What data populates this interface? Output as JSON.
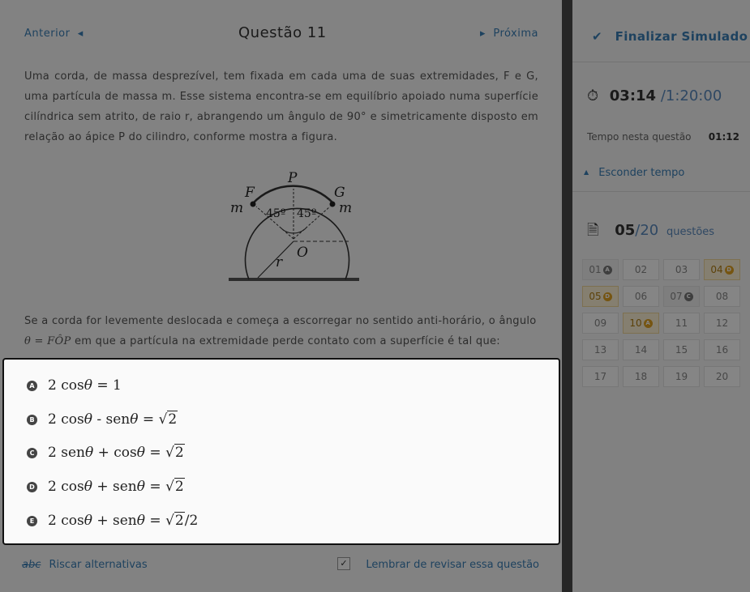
{
  "nav": {
    "prev_label": "Anterior",
    "prev_icon": "chevron-left-icon",
    "title": "Questão 11",
    "next_label": "Próxima",
    "next_icon": "chevron-right-icon"
  },
  "question": {
    "text1": "Uma corda, de massa desprezível, tem fixada em cada uma de suas extremidades, F e G, uma partícula de massa m. Esse sistema encontra-se em equilíbrio apoiado numa superfície cilíndrica sem atrito, de raio r, abrangendo um ângulo de 90° e simetricamente disposto em relação ao ápice P do cilindro, conforme mostra a figura.",
    "text2_pre": "Se a corda for levemente deslocada e começa a escorregar no sentido anti-horário, o ângulo",
    "text2_math": "θ = FÔP",
    "text2_post": " em que a partícula na extremidade  perde contato com a superfície é tal que:",
    "figure": {
      "p": "P",
      "f": "F",
      "g": "G",
      "m_left": "m",
      "m_right": "m",
      "angle_left": "45º",
      "angle_right": "45º",
      "o": "O",
      "r": "r"
    }
  },
  "options": [
    {
      "letter": "A",
      "pre": "2 cos",
      "theta": "θ",
      "mid": " = 1",
      "mid2": "",
      "theta2": "",
      "rhs_sqrt": "",
      "tail": ""
    },
    {
      "letter": "B",
      "pre": "2 cos",
      "theta": "θ",
      "mid": " - sen",
      "theta2": "θ",
      "mid2": " = ",
      "rhs_sqrt": "2",
      "tail": ""
    },
    {
      "letter": "C",
      "pre": "2 sen",
      "theta": "θ",
      "mid": " + cos",
      "theta2": "θ",
      "mid2": " = ",
      "rhs_sqrt": "2",
      "tail": ""
    },
    {
      "letter": "D",
      "pre": "2 cos",
      "theta": "θ",
      "mid": " + sen",
      "theta2": "θ",
      "mid2": " = ",
      "rhs_sqrt": "2",
      "tail": ""
    },
    {
      "letter": "E",
      "pre": "2 cos",
      "theta": "θ",
      "mid": " + sen",
      "theta2": "θ",
      "mid2": " = ",
      "rhs_sqrt": "2",
      "tail": "/2"
    }
  ],
  "footer": {
    "strike_abc": "abc",
    "strike_label": "Riscar alternativas",
    "review_label": "Lembrar de revisar essa questão",
    "review_checked": "✓"
  },
  "sidebar": {
    "finish_label": "Finalizar Simulado",
    "timer_current": "03:14",
    "timer_total": "/1:20:00",
    "question_time_label": "Tempo nesta questão",
    "question_time_value": "01:12",
    "hide_time_label": "Esconder tempo",
    "count_done": "05",
    "count_total": "/20",
    "count_label": "questões",
    "grid": [
      {
        "n": "01",
        "badge": "A",
        "state": "ans"
      },
      {
        "n": "02",
        "badge": "",
        "state": ""
      },
      {
        "n": "03",
        "badge": "",
        "state": ""
      },
      {
        "n": "04",
        "badge": "D",
        "state": "rev"
      },
      {
        "n": "05",
        "badge": "D",
        "state": "rev"
      },
      {
        "n": "06",
        "badge": "",
        "state": ""
      },
      {
        "n": "07",
        "badge": "C",
        "state": "ans"
      },
      {
        "n": "08",
        "badge": "",
        "state": ""
      },
      {
        "n": "09",
        "badge": "",
        "state": ""
      },
      {
        "n": "10",
        "badge": "A",
        "state": "rev"
      },
      {
        "n": "11",
        "badge": "",
        "state": ""
      },
      {
        "n": "12",
        "badge": "",
        "state": ""
      },
      {
        "n": "13",
        "badge": "",
        "state": ""
      },
      {
        "n": "14",
        "badge": "",
        "state": ""
      },
      {
        "n": "15",
        "badge": "",
        "state": ""
      },
      {
        "n": "16",
        "badge": "",
        "state": ""
      },
      {
        "n": "17",
        "badge": "",
        "state": ""
      },
      {
        "n": "18",
        "badge": "",
        "state": ""
      },
      {
        "n": "19",
        "badge": "",
        "state": ""
      },
      {
        "n": "20",
        "badge": "",
        "state": ""
      }
    ]
  },
  "colors": {
    "accent": "#3a7fb7",
    "review": "#e3a321"
  }
}
